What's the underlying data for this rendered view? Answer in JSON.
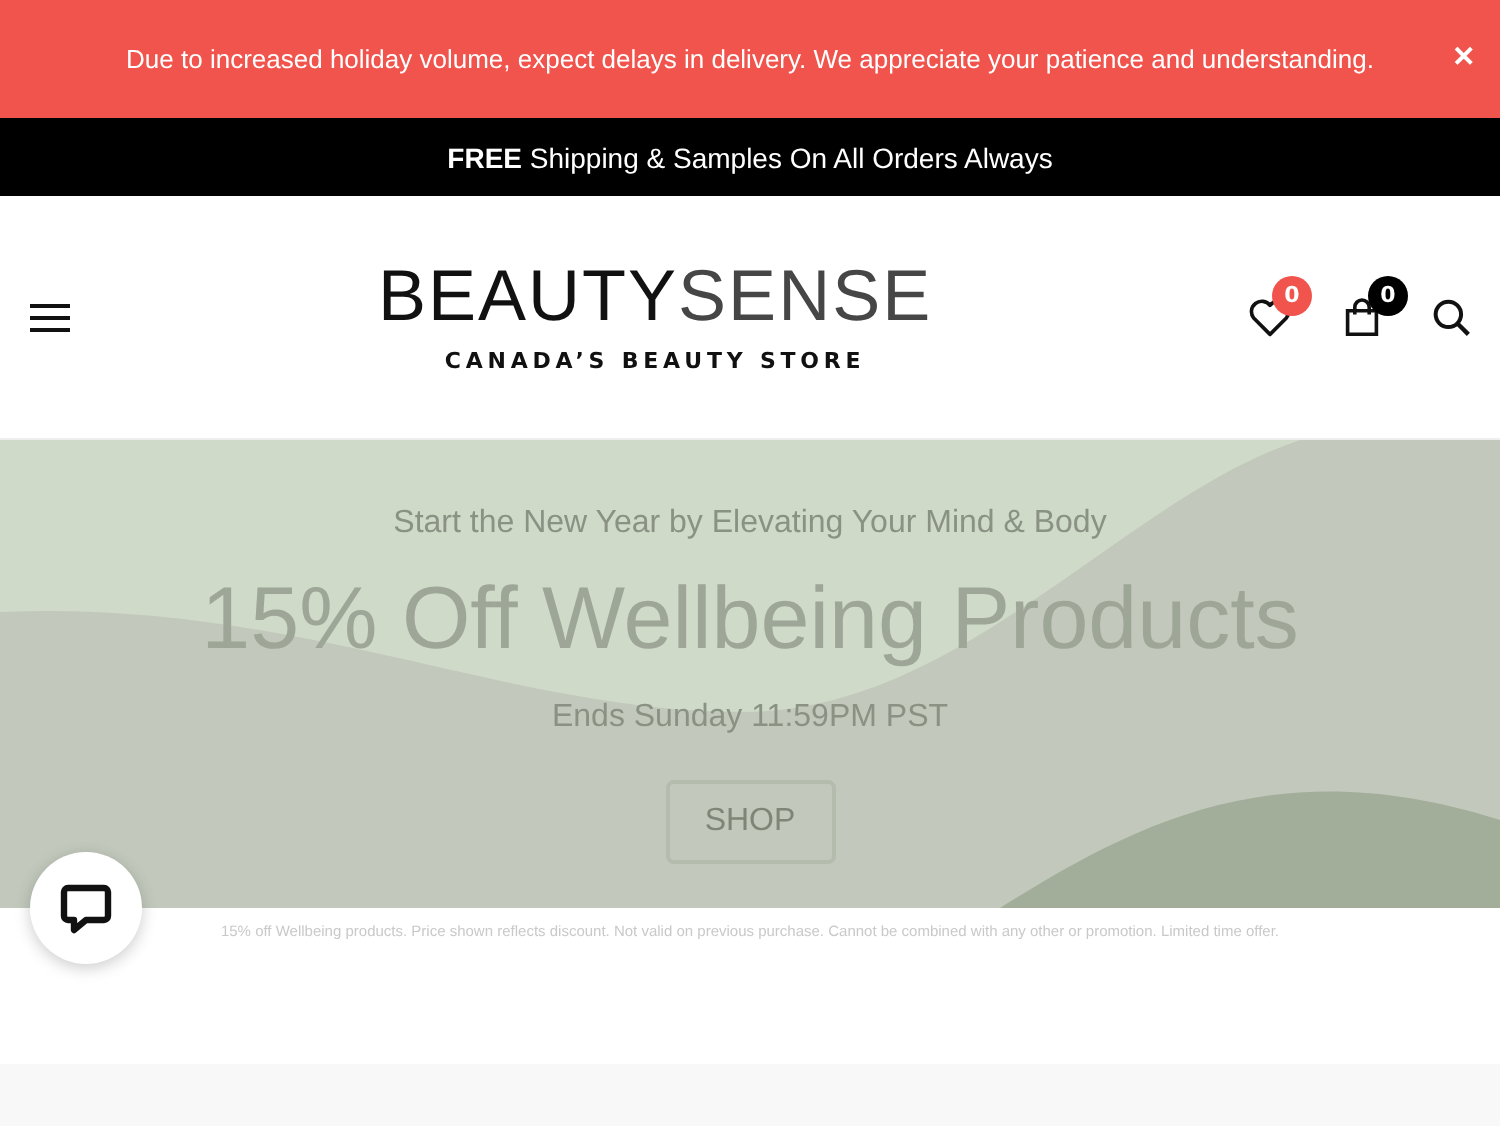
{
  "alert_bar": {
    "message": "Due to increased holiday volume, expect delays in delivery. We appreciate your patience and understanding.",
    "close": "✕"
  },
  "promo_bar": {
    "text": "**FREE** Shipping & Samples On All Orders Always"
  },
  "header": {
    "logo": {
      "strong": "BEAUTY",
      "light": "SENSE"
    },
    "tagline": "CANADA’S BEAUTY STORE",
    "wishlist_count": "0",
    "cart_count": "0"
  },
  "hero": {
    "eyebrow": "Start the New Year by Elevating Your Mind & Body",
    "headline": "15% Off Wellbeing Products",
    "subline": "Ends Sunday 11:59PM PST",
    "button": "SHOP",
    "disclaimer": "15% off Wellbeing products. Price shown reflects discount. Not valid on previous purchase. Cannot be combined with any other or promotion. Limited time offer."
  }
}
